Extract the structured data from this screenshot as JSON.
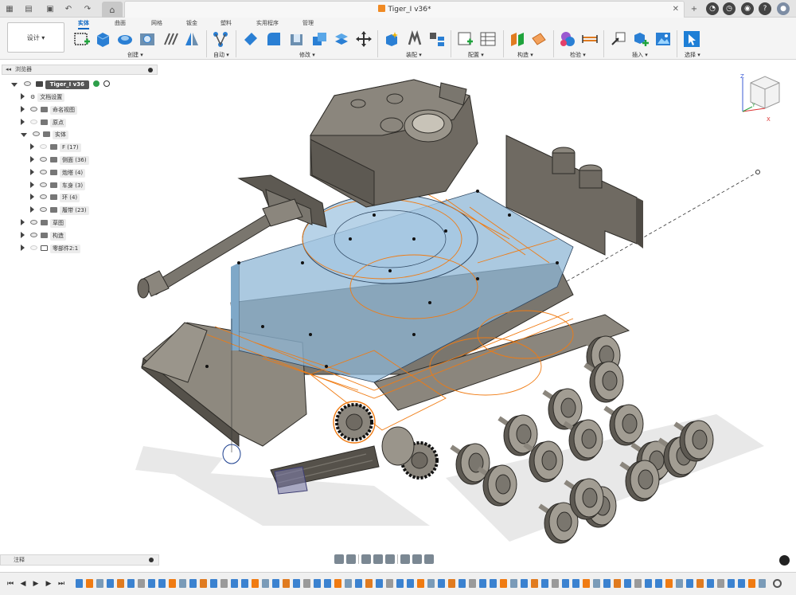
{
  "titlebar": {
    "document_title": "Tiger_I v36*",
    "icons": [
      "apps-grid-icon",
      "file-menu-icon",
      "save-icon",
      "undo-icon",
      "redo-icon",
      "home-icon"
    ],
    "right_icons": [
      "new-tab-icon",
      "extensions-icon",
      "job-status-icon",
      "notifications-icon",
      "help-icon",
      "user-avatar-icon"
    ]
  },
  "toolbar": {
    "workspace_button": "设计 ▾",
    "tabs": [
      "实体",
      "曲面",
      "网格",
      "钣金",
      "塑料",
      "实用程序",
      "管理"
    ],
    "active_tab": "实体",
    "groups": [
      "创建 ▾",
      "自动 ▾",
      "修改 ▾",
      "装配 ▾",
      "配置 ▾",
      "构造 ▾",
      "检验 ▾",
      "插入 ▾",
      "选择 ▾"
    ]
  },
  "browser": {
    "title": "浏览器",
    "root": "Tiger_I v36",
    "items": [
      {
        "label": "文档设置",
        "indent": 1,
        "kind": "gear"
      },
      {
        "label": "命名视图",
        "indent": 1,
        "kind": "folder"
      },
      {
        "label": "原点",
        "indent": 1,
        "kind": "folder"
      },
      {
        "label": "实体",
        "indent": 1,
        "kind": "folder",
        "open": true
      },
      {
        "label": "F (17)",
        "indent": 2,
        "kind": "folder"
      },
      {
        "label": "侧面 (36)",
        "indent": 2,
        "kind": "folder"
      },
      {
        "label": "炮塔 (4)",
        "indent": 2,
        "kind": "folder"
      },
      {
        "label": "车身 (3)",
        "indent": 2,
        "kind": "folder"
      },
      {
        "label": "环 (4)",
        "indent": 2,
        "kind": "folder"
      },
      {
        "label": "履带 (23)",
        "indent": 2,
        "kind": "folder"
      },
      {
        "label": "草图",
        "indent": 1,
        "kind": "folder"
      },
      {
        "label": "构造",
        "indent": 1,
        "kind": "folder"
      },
      {
        "label": "零部件2:1",
        "indent": 1,
        "kind": "component"
      }
    ]
  },
  "comments": {
    "title": "注释"
  },
  "viewcube": {
    "axis_z": "Z",
    "axis_y": "Y",
    "axis_x": "X"
  },
  "colors": {
    "accent": "#0b66c3",
    "sketch": "#f07b12",
    "body": "#6f6a62",
    "selection": "#8fb7d6"
  }
}
